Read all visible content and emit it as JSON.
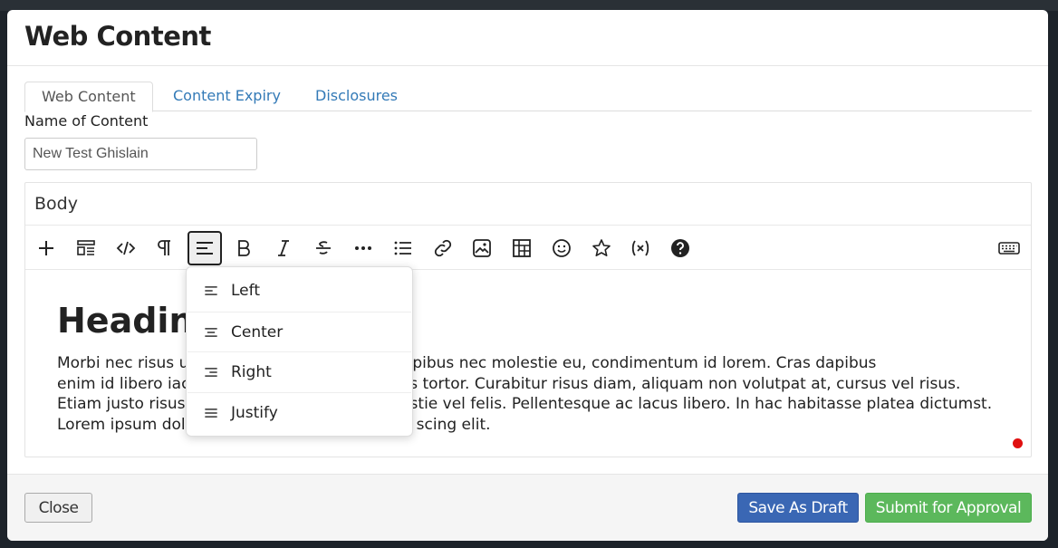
{
  "modal": {
    "title": "Web Content"
  },
  "tabs": [
    {
      "label": "Web Content",
      "active": true
    },
    {
      "label": "Content Expiry",
      "active": false
    },
    {
      "label": "Disclosures",
      "active": false
    }
  ],
  "form": {
    "name_label": "Name of Content",
    "name_value": "New Test Ghislain"
  },
  "editor": {
    "label": "Body",
    "toolbar": [
      {
        "icon": "plus-icon",
        "active": false
      },
      {
        "icon": "block-template-icon",
        "active": false
      },
      {
        "icon": "code-icon",
        "active": false
      },
      {
        "icon": "paragraph-icon",
        "active": false
      },
      {
        "icon": "align-left-icon",
        "active": true
      },
      {
        "icon": "bold-icon",
        "active": false
      },
      {
        "icon": "italic-icon",
        "active": false
      },
      {
        "icon": "strikethrough-icon",
        "active": false
      },
      {
        "icon": "more-icon",
        "active": false
      },
      {
        "icon": "list-icon",
        "active": false
      },
      {
        "icon": "link-icon",
        "active": false
      },
      {
        "icon": "image-icon",
        "active": false
      },
      {
        "icon": "table-icon",
        "active": false
      },
      {
        "icon": "emoji-icon",
        "active": false
      },
      {
        "icon": "star-icon",
        "active": false
      },
      {
        "icon": "variable-icon",
        "active": false
      },
      {
        "icon": "help-icon",
        "active": false
      },
      {
        "icon": "keyboard-icon",
        "active": false
      }
    ],
    "heading": "Heading",
    "paragraph_lines": [
      "Morbi nec risus u",
      "dolor mi, dapibus nec molestie eu, condimentum id lorem. Cras dapibus",
      "enim id libero iac",
      "us tortor. Curabitur risus diam, aliquam non volutpat at, cursus vel risus.",
      "Etiam justo risus",
      "stie vel felis. Pellentesque ac lacus libero. In hac habitasse platea dictumst.",
      "Lorem ipsum dol",
      "scing elit."
    ]
  },
  "align_menu": {
    "items": [
      {
        "label": "Left",
        "icon": "align-left-icon"
      },
      {
        "label": "Center",
        "icon": "align-center-icon"
      },
      {
        "label": "Right",
        "icon": "align-right-icon"
      },
      {
        "label": "Justify",
        "icon": "align-justify-icon"
      }
    ]
  },
  "footer": {
    "close_label": "Close",
    "draft_label": "Save As Draft",
    "submit_label": "Submit for Approval"
  },
  "colors": {
    "primary_blue": "#3a67b4",
    "success_green": "#5cb85c",
    "link_blue": "#337ab7"
  }
}
